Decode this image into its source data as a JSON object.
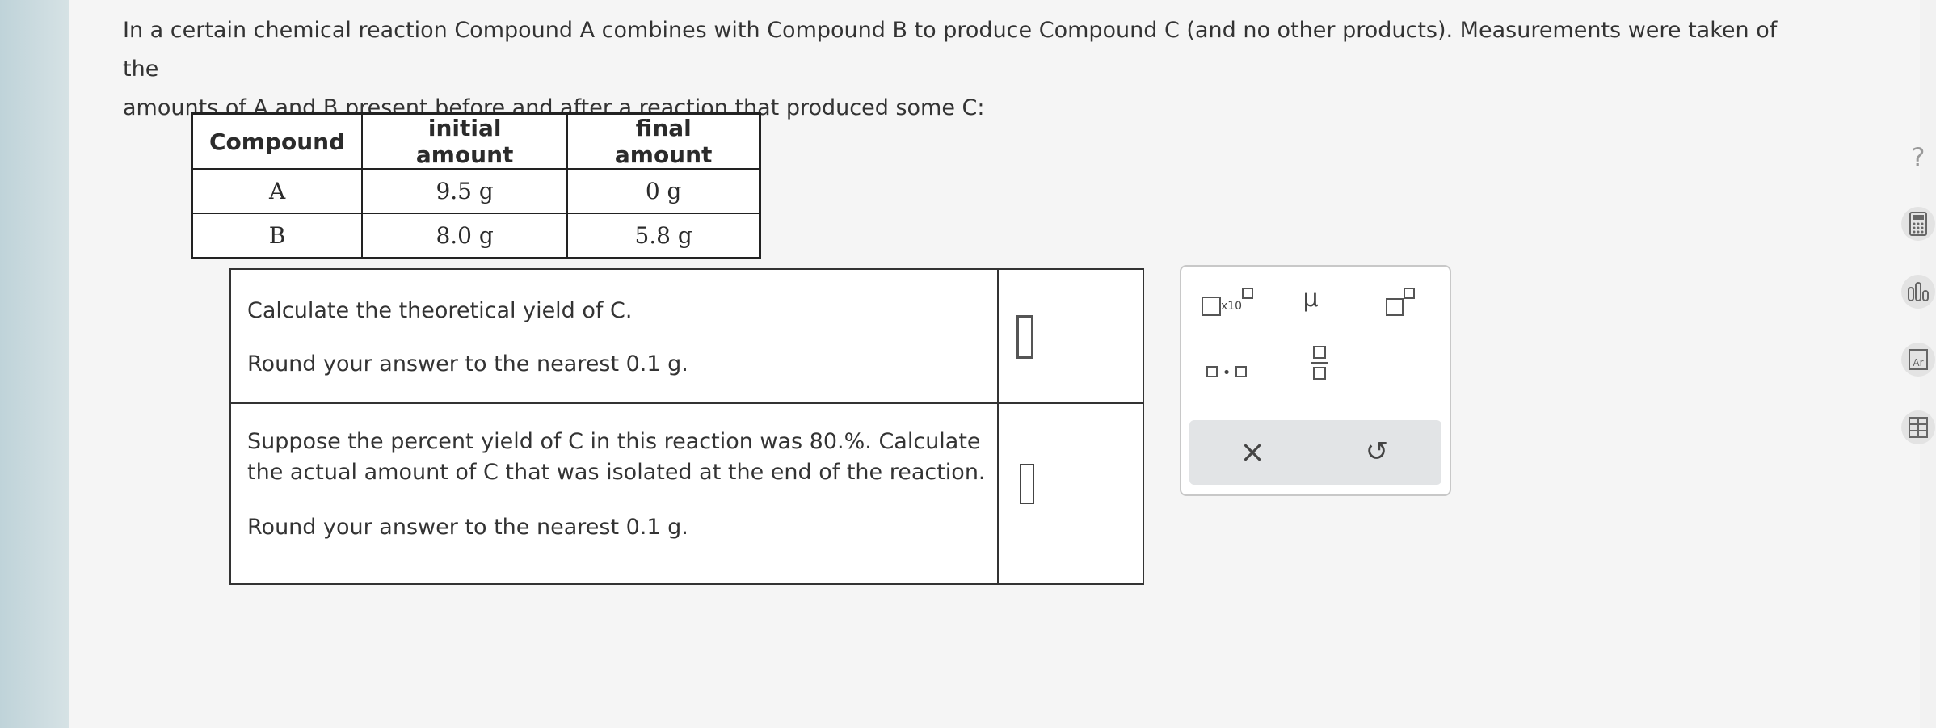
{
  "intro": {
    "line1": "In a certain chemical reaction Compound A combines with Compound B to produce Compound C (and no other products). Measurements were taken of the",
    "line2": "amounts of A and B present before and after a reaction that produced some C:"
  },
  "table": {
    "headers": [
      "Compound",
      "initial amount",
      "final amount"
    ],
    "rows": [
      [
        "A",
        "9.5 g",
        "0 g"
      ],
      [
        "B",
        "8.0 g",
        "5.8 g"
      ]
    ]
  },
  "questions": [
    {
      "prompt": "Calculate the theoretical yield of C.",
      "round": "Round your answer to the nearest 0.1 g."
    },
    {
      "prompt_line1": "Suppose the percent yield of C in this reaction was 80.%. Calculate",
      "prompt_line2": "the actual amount of C that was isolated at the end of the reaction.",
      "round": "Round your answer to the nearest 0.1 g."
    }
  ],
  "palette": {
    "sci_notation_label": "x10",
    "mu_label": "μ",
    "clear_label": "×",
    "undo_label": "↺"
  },
  "tools": {
    "help_label": "?"
  }
}
